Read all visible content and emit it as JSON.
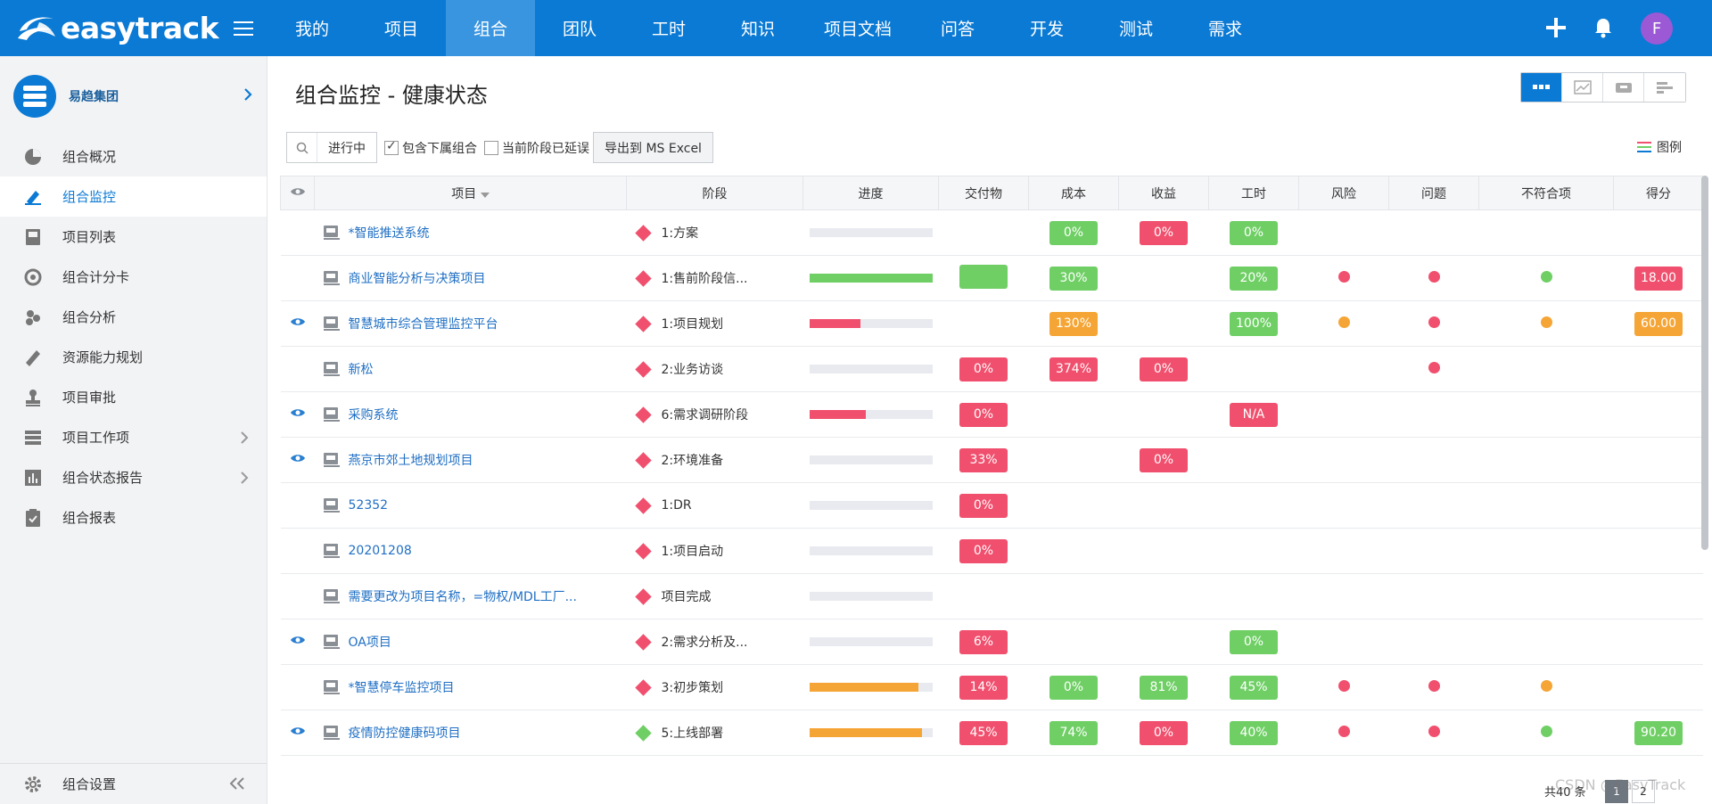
{
  "brand": {
    "name": "easytrack"
  },
  "nav": {
    "items": [
      {
        "label": "我的",
        "active": false
      },
      {
        "label": "项目",
        "active": false
      },
      {
        "label": "组合",
        "active": true
      },
      {
        "label": "团队",
        "active": false
      },
      {
        "label": "工时",
        "active": false
      },
      {
        "label": "知识",
        "active": false
      },
      {
        "label": "项目文档",
        "active": false
      },
      {
        "label": "问答",
        "active": false
      },
      {
        "label": "开发",
        "active": false
      },
      {
        "label": "测试",
        "active": false
      },
      {
        "label": "需求",
        "active": false
      }
    ],
    "avatar_letter": "F"
  },
  "sidebar": {
    "org_name": "易趋集团",
    "items": [
      {
        "label": "组合概况",
        "icon": "pie-chart-icon"
      },
      {
        "label": "组合监控",
        "icon": "monitor-pen-icon",
        "active": true
      },
      {
        "label": "项目列表",
        "icon": "inbox-icon"
      },
      {
        "label": "组合计分卡",
        "icon": "target-icon"
      },
      {
        "label": "组合分析",
        "icon": "cluster-icon"
      },
      {
        "label": "资源能力规划",
        "icon": "ruler-icon"
      },
      {
        "label": "项目审批",
        "icon": "stamp-icon"
      },
      {
        "label": "项目工作项",
        "icon": "list-icon",
        "has_arrow": true
      },
      {
        "label": "组合状态报告",
        "icon": "bar-report-icon",
        "has_arrow": true
      },
      {
        "label": "组合报表",
        "icon": "clipboard-icon"
      }
    ],
    "footer_label": "组合设置"
  },
  "page": {
    "title": "组合监控 - 健康状态"
  },
  "toolbar": {
    "status_value": "进行中",
    "include_sub_label": "包含下属组合",
    "include_sub_checked": true,
    "stage_delayed_label": "当前阶段已延误",
    "stage_delayed_checked": false,
    "export_label": "导出到 MS Excel",
    "legend_label": "图例"
  },
  "table": {
    "headers": {
      "project": "项目",
      "stage": "阶段",
      "progress": "进度",
      "deliverables": "交付物",
      "cost": "成本",
      "revenue": "收益",
      "hours": "工时",
      "risk": "风险",
      "issue": "问题",
      "nonconform": "不符合项",
      "score": "得分"
    },
    "rows": [
      {
        "eye": false,
        "name": "*智能推送系统",
        "stage": "1:方案",
        "stage_color": "#f0506e",
        "progress": 0,
        "progress_color": "#f0506e",
        "deliv": null,
        "cost": {
          "text": "0%",
          "color": "#6fcf65"
        },
        "revenue": {
          "text": "0%",
          "color": "#f0506e"
        },
        "hours": {
          "text": "0%",
          "color": "#6fcf65"
        },
        "risk": null,
        "issue": null,
        "nc": null,
        "score": null
      },
      {
        "eye": false,
        "name": "商业智能分析与决策项目",
        "stage": "1:售前阶段信...",
        "stage_color": "#f0506e",
        "progress": 100,
        "progress_color": "#6fcf65",
        "deliv": {
          "text": "",
          "color": "#6fcf65"
        },
        "cost": {
          "text": "30%",
          "color": "#6fcf65"
        },
        "revenue": null,
        "hours": {
          "text": "20%",
          "color": "#6fcf65"
        },
        "risk": "#f0506e",
        "issue": "#f0506e",
        "nc": "#6fcf65",
        "score": {
          "text": "18.00",
          "color": "#f0506e"
        }
      },
      {
        "eye": true,
        "name": "智慧城市综合管理监控平台",
        "stage": "1:项目规划",
        "stage_color": "#f0506e",
        "progress": 42,
        "progress_color": "#f0506e",
        "deliv": null,
        "cost": {
          "text": "130%",
          "color": "#f5a535"
        },
        "revenue": null,
        "hours": {
          "text": "100%",
          "color": "#6fcf65"
        },
        "risk": "#f5a535",
        "issue": "#f0506e",
        "nc": "#f5a535",
        "score": {
          "text": "60.00",
          "color": "#f5a535"
        }
      },
      {
        "eye": false,
        "name": "新松",
        "stage": "2:业务访谈",
        "stage_color": "#f0506e",
        "progress": 0,
        "progress_color": "#f0506e",
        "deliv": {
          "text": "0%",
          "color": "#f0506e"
        },
        "cost": {
          "text": "374%",
          "color": "#f0506e"
        },
        "revenue": {
          "text": "0%",
          "color": "#f0506e"
        },
        "hours": null,
        "risk": null,
        "issue": "#f0506e",
        "nc": null,
        "score": null
      },
      {
        "eye": true,
        "name": "采购系统",
        "stage": "6:需求调研阶段",
        "stage_color": "#f0506e",
        "progress": 46,
        "progress_color": "#f0506e",
        "deliv": {
          "text": "0%",
          "color": "#f0506e"
        },
        "cost": null,
        "revenue": null,
        "hours": {
          "text": "N/A",
          "color": "#f0506e"
        },
        "risk": null,
        "issue": null,
        "nc": null,
        "score": null
      },
      {
        "eye": true,
        "name": "燕京市郊土地规划项目",
        "stage": "2:环境准备",
        "stage_color": "#f0506e",
        "progress": 0,
        "progress_color": "#f0506e",
        "deliv": {
          "text": "33%",
          "color": "#f0506e"
        },
        "cost": null,
        "revenue": {
          "text": "0%",
          "color": "#f0506e"
        },
        "hours": null,
        "risk": null,
        "issue": null,
        "nc": null,
        "score": null
      },
      {
        "eye": false,
        "name": "52352",
        "stage": "1:DR",
        "stage_color": "#f0506e",
        "progress": 0,
        "progress_color": "#f0506e",
        "deliv": {
          "text": "0%",
          "color": "#f0506e"
        },
        "cost": null,
        "revenue": null,
        "hours": null,
        "risk": null,
        "issue": null,
        "nc": null,
        "score": null
      },
      {
        "eye": false,
        "name": "20201208",
        "stage": "1:项目启动",
        "stage_color": "#f0506e",
        "progress": 0,
        "progress_color": "#f0506e",
        "deliv": {
          "text": "0%",
          "color": "#f0506e"
        },
        "cost": null,
        "revenue": null,
        "hours": null,
        "risk": null,
        "issue": null,
        "nc": null,
        "score": null
      },
      {
        "eye": false,
        "name": "需要更改为项目名称，=物权/MDL工厂...",
        "stage": "项目完成",
        "stage_color": "#f0506e",
        "progress": 0,
        "progress_color": "#f0506e",
        "deliv": null,
        "cost": null,
        "revenue": null,
        "hours": null,
        "risk": null,
        "issue": null,
        "nc": null,
        "score": null
      },
      {
        "eye": true,
        "name": "OA项目",
        "stage": "2:需求分析及...",
        "stage_color": "#f0506e",
        "progress": 0,
        "progress_color": "#f0506e",
        "deliv": {
          "text": "6%",
          "color": "#f0506e"
        },
        "cost": null,
        "revenue": null,
        "hours": {
          "text": "0%",
          "color": "#6fcf65"
        },
        "risk": null,
        "issue": null,
        "nc": null,
        "score": null
      },
      {
        "eye": false,
        "name": "*智慧停车监控项目",
        "stage": "3:初步策划",
        "stage_color": "#f0506e",
        "progress": 89,
        "progress_color": "#f5a535",
        "deliv": {
          "text": "14%",
          "color": "#f0506e"
        },
        "cost": {
          "text": "0%",
          "color": "#6fcf65"
        },
        "revenue": {
          "text": "81%",
          "color": "#6fcf65"
        },
        "hours": {
          "text": "45%",
          "color": "#6fcf65"
        },
        "risk": "#f0506e",
        "issue": "#f0506e",
        "nc": "#f5a535",
        "score": null
      },
      {
        "eye": true,
        "name": "疫情防控健康码项目",
        "stage": "5:上线部署",
        "stage_color": "#6fcf65",
        "progress": 92,
        "progress_color": "#f5a535",
        "deliv": {
          "text": "45%",
          "color": "#f0506e"
        },
        "cost": {
          "text": "74%",
          "color": "#6fcf65"
        },
        "revenue": {
          "text": "0%",
          "color": "#f0506e"
        },
        "hours": {
          "text": "40%",
          "color": "#6fcf65"
        },
        "risk": "#f0506e",
        "issue": "#f0506e",
        "nc": "#6fcf65",
        "score": {
          "text": "90.20",
          "color": "#6fcf65"
        }
      }
    ],
    "total_label": "共40 条"
  },
  "pager": {
    "pages": [
      "1",
      "2"
    ],
    "current": "1"
  },
  "watermark": "CSDN @EasyTrack",
  "colors": {
    "primary": "#0b7ad4",
    "red": "#f0506e",
    "green": "#6fcf65",
    "orange": "#f5a535"
  }
}
